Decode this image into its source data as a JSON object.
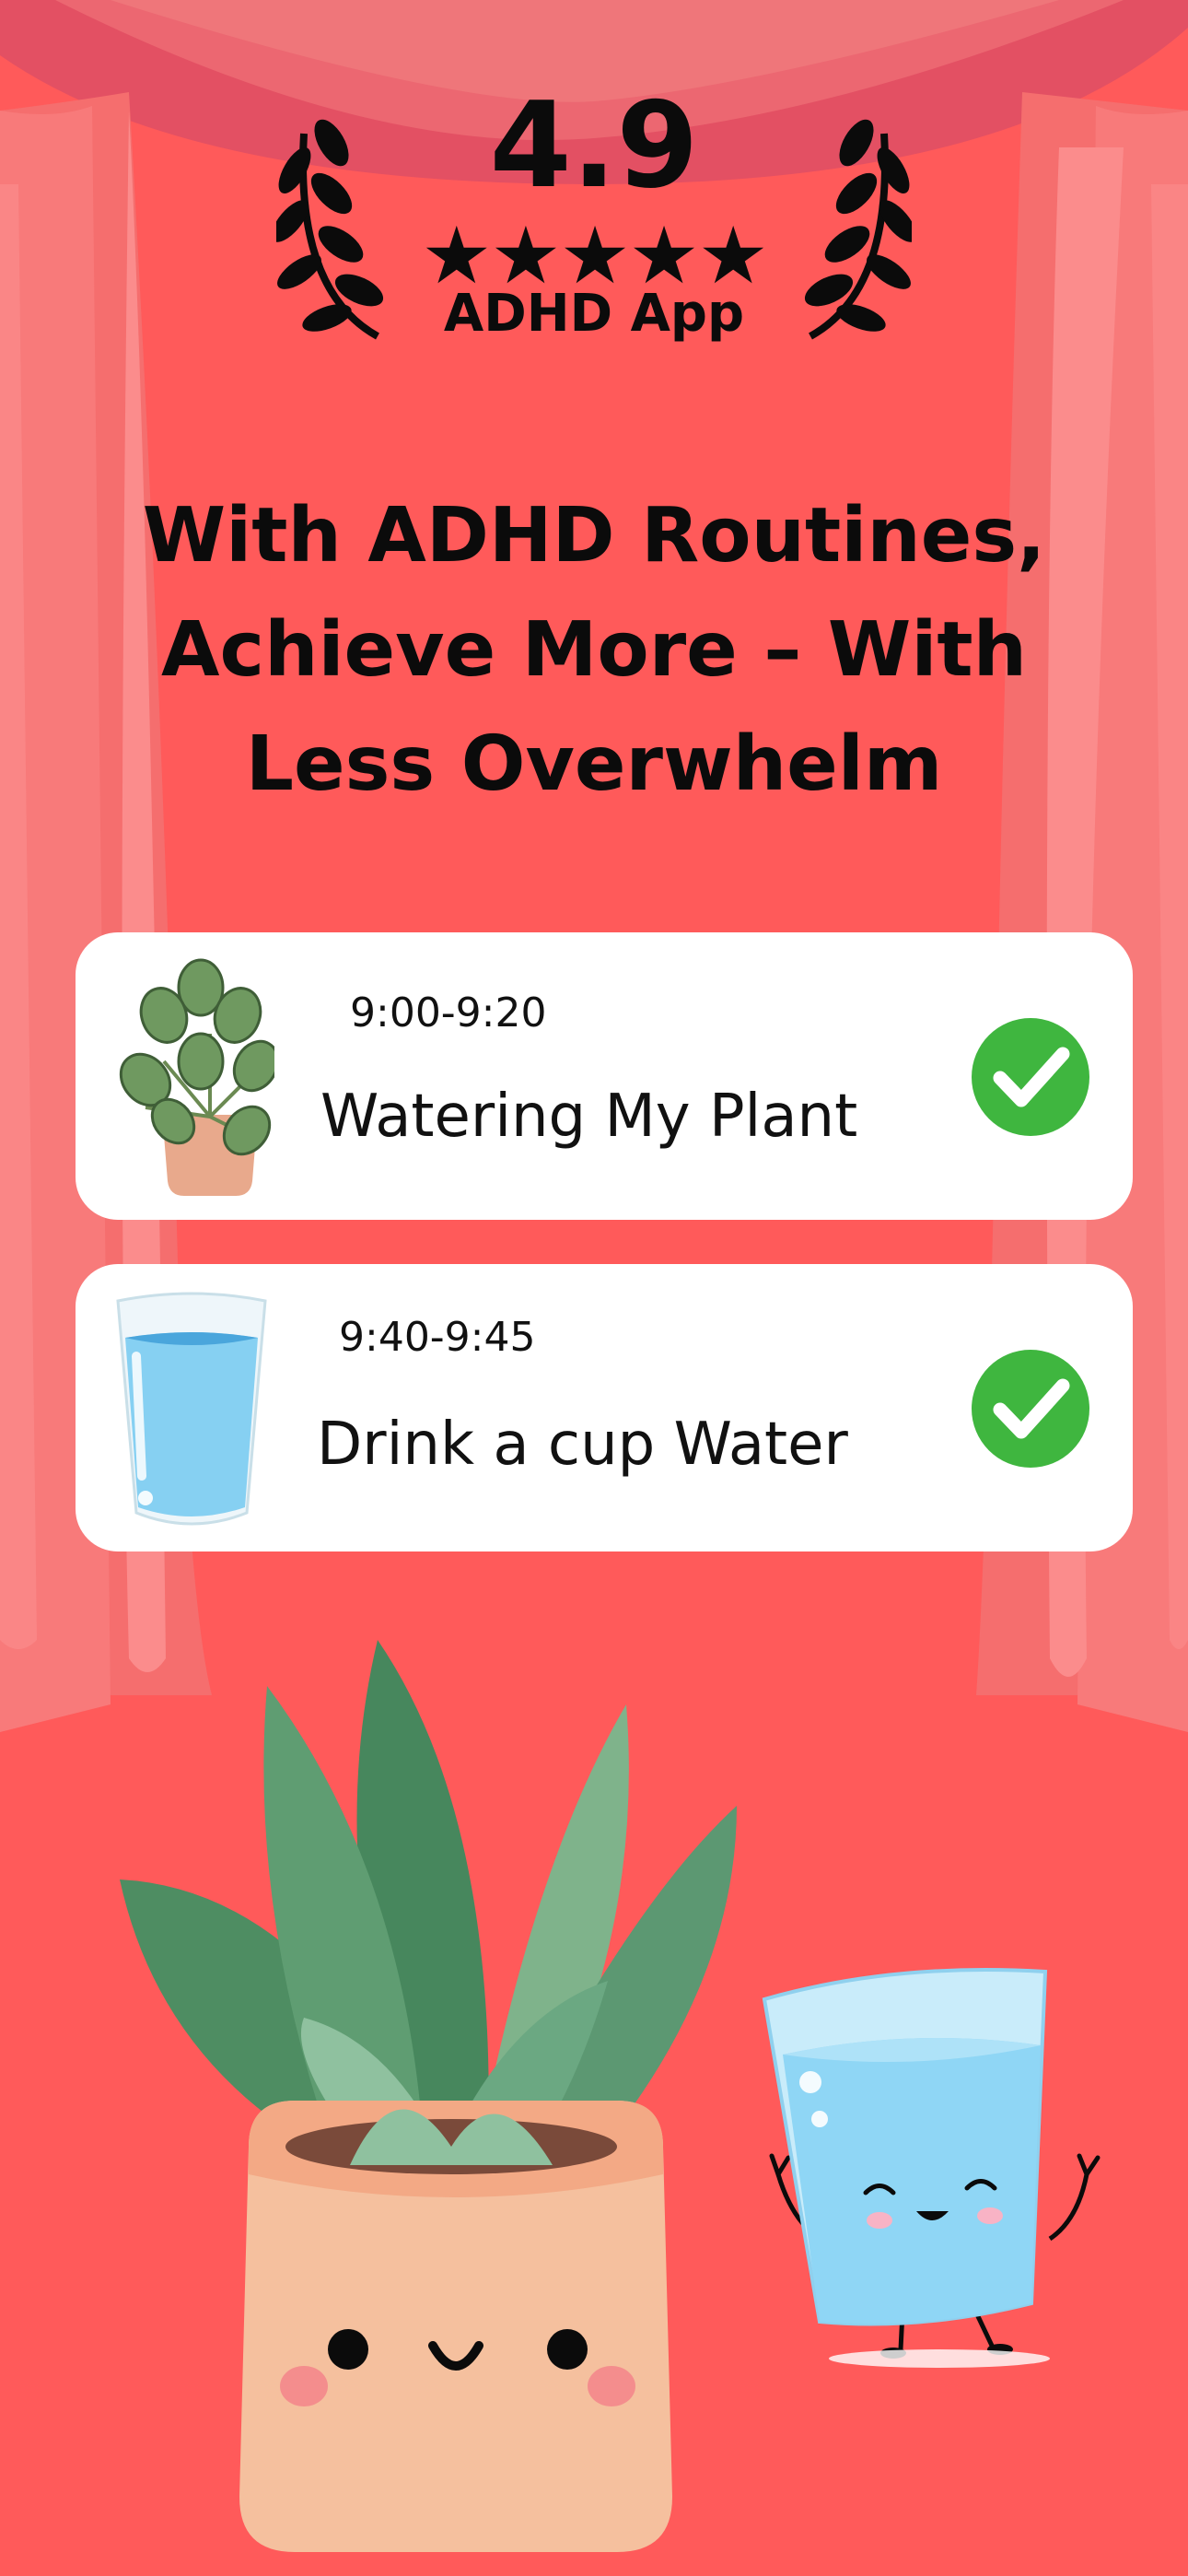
{
  "rating": {
    "value": "4.9",
    "stars": "★★★★★",
    "label": "ADHD App"
  },
  "headline": {
    "line1": "With ADHD Routines,",
    "line2": "Achieve More – With",
    "line3": "Less Overwhelm"
  },
  "tasks": [
    {
      "time": "9:00-9:20",
      "title": "Watering My Plant",
      "icon": "plant-icon",
      "status": "done"
    },
    {
      "time": "9:40-9:45",
      "title": "Drink a cup Water",
      "icon": "water-glass-icon",
      "status": "done"
    }
  ],
  "colors": {
    "background": "#ff5a5a",
    "curtain": "#f77272",
    "check_green": "#3fb63f",
    "card": "#ffffff",
    "text": "#0b0b0b"
  }
}
